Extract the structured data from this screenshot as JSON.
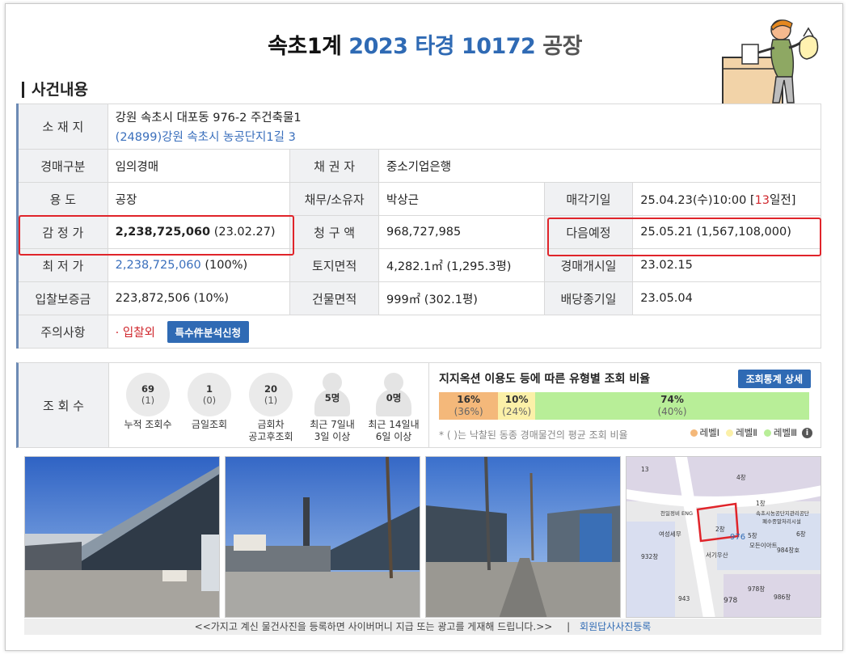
{
  "title": {
    "court": "속초1계",
    "case": "2023 타경 10172",
    "kind": "공장"
  },
  "section_title": "사건내용",
  "info": {
    "location_label": "소 재 지",
    "location_addr": "강원 속초시 대포동 976-2 주건축물1",
    "location_road": "(24899)강원 속초시 농공단지1길 3",
    "auction_type_label": "경매구분",
    "auction_type": "임의경매",
    "creditor_label": "채 권 자",
    "creditor": "중소기업은행",
    "usage_label": "용 도",
    "usage": "공장",
    "debtor_label": "채무/소유자",
    "debtor": "박상근",
    "sale_date_label": "매각기일",
    "sale_date": "25.04.23(수)10:00 [",
    "sale_dday": "13",
    "sale_dday_suffix": "일전]",
    "appraisal_label": "감 정 가",
    "appraisal_value": "2,238,725,060",
    "appraisal_date": "(23.02.27)",
    "claim_label": "청 구 액",
    "claim": "968,727,985",
    "next_label": "다음예정",
    "next_value": "25.05.21 (1,567,108,000)",
    "min_price_label": "최 저 가",
    "min_price": "2,238,725,060",
    "min_price_pct": "(100%)",
    "land_area_label": "토지면적",
    "land_area": "4,282.1㎡ (1,295.3평)",
    "start_date_label": "경매개시일",
    "start_date": "23.02.15",
    "deposit_label": "입찰보증금",
    "deposit": "223,872,506 (10%)",
    "building_area_label": "건물면적",
    "building_area": "999㎡ (302.1평)",
    "dividend_label": "배당종기일",
    "dividend_date": "23.05.04",
    "notice_label": "주의사항",
    "notice_item": "· 입찰외",
    "analysis_button": "특수件분석신청"
  },
  "views": {
    "label": "조 회 수",
    "counters": [
      {
        "n": "69",
        "p": "(1)",
        "cap1": "누적 조회수",
        "cap2": ""
      },
      {
        "n": "1",
        "p": "(0)",
        "cap1": "금일조회",
        "cap2": ""
      },
      {
        "n": "20",
        "p": "(1)",
        "cap1": "금회차",
        "cap2": "공고후조회"
      }
    ],
    "people": [
      {
        "n": "5명",
        "cap1": "최근 7일내",
        "cap2": "3일 이상"
      },
      {
        "n": "0명",
        "cap1": "최근 14일내",
        "cap2": "6일 이상"
      }
    ],
    "ratio_title": "지지옥션 이용도 등에 따른 유형별 조회 비율",
    "detail_button": "조회통계 상세",
    "segments": [
      {
        "value": "16%",
        "avg": "(36%)",
        "pct": 16,
        "color": "#f4b87a"
      },
      {
        "value": "10%",
        "avg": "(24%)",
        "pct": 10,
        "color": "#fbf0a8"
      },
      {
        "value": "74%",
        "avg": "(40%)",
        "pct": 74,
        "color": "#b8ee98"
      }
    ],
    "note": "* ( )는 낙찰된 동종 경매물건의 평균 조회 비율",
    "legend": [
      {
        "label": "레벨Ⅰ",
        "color": "#f4b87a"
      },
      {
        "label": "레벨Ⅱ",
        "color": "#fbf0a8"
      },
      {
        "label": "레벨Ⅲ",
        "color": "#b8ee98"
      }
    ]
  },
  "footer": {
    "text": "<<가지고 계신 물건사진을 등록하면 사이버머니 지급 또는 광고를 게재해 드립니다.>>",
    "separator": "|",
    "link": "회원답사사진등록"
  },
  "map": {
    "labels": [
      "13",
      "976",
      "2창",
      "서기우산",
      "984창호",
      "모든이아트",
      "여성세무",
      "932창",
      "978",
      "978창",
      "986창",
      "943",
      "1창",
      "천일정비 ENG",
      "속초시농공단지관리공단",
      "폐수종말처리시설",
      "4창",
      "5창",
      "6창"
    ]
  }
}
